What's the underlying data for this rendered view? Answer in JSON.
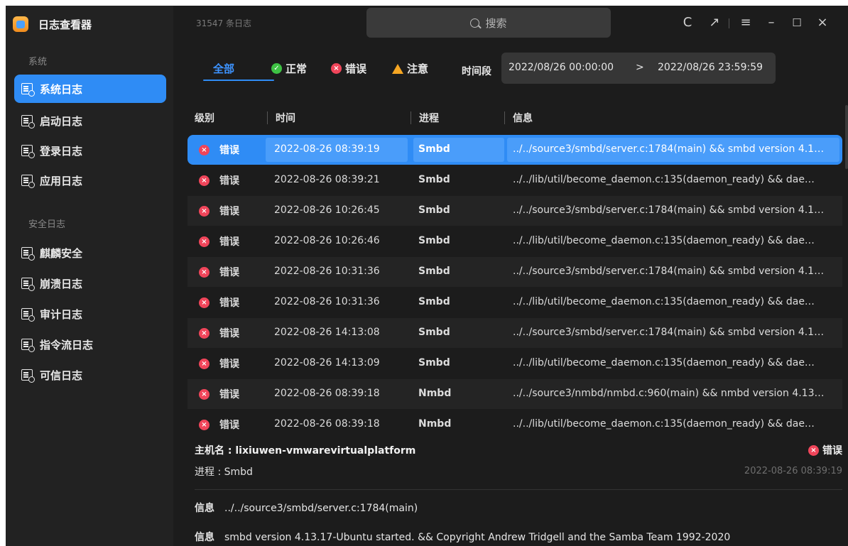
{
  "app": {
    "title": "日志查看器"
  },
  "sidebar": {
    "section_system": "系统",
    "section_security": "安全日志",
    "items": [
      {
        "label": "系统日志"
      },
      {
        "label": "启动日志"
      },
      {
        "label": "登录日志"
      },
      {
        "label": "应用日志"
      },
      {
        "label": "麒麟安全"
      },
      {
        "label": "崩溃日志"
      },
      {
        "label": "审计日志"
      },
      {
        "label": "指令流日志"
      },
      {
        "label": "可信日志"
      }
    ]
  },
  "titlebar": {
    "count": "31547 条日志",
    "search_placeholder": "搜索",
    "refresh_icon": "C",
    "export_icon": "↗",
    "menu_icon": "≡",
    "minimize_icon": "–",
    "maximize_icon": "☐",
    "close_icon": "×"
  },
  "filters": {
    "all": "全部",
    "normal": "正常",
    "error": "错误",
    "warning": "注意",
    "period_label": "时间段",
    "start": "2022/08/26 00:00:00",
    "arrow": ">",
    "end": "2022/08/26 23:59:59"
  },
  "table": {
    "headers": {
      "level": "级别",
      "time": "时间",
      "process": "进程",
      "info": "信息"
    },
    "rows": [
      {
        "level": "错误",
        "time": "2022-08-26 08:39:19",
        "process": "Smbd",
        "info": "../../source3/smbd/server.c:1784(main) && smbd version 4.1…"
      },
      {
        "level": "错误",
        "time": "2022-08-26 08:39:21",
        "process": "Smbd",
        "info": "../../lib/util/become_daemon.c:135(daemon_ready) && dae…"
      },
      {
        "level": "错误",
        "time": "2022-08-26 10:26:45",
        "process": "Smbd",
        "info": "../../source3/smbd/server.c:1784(main) && smbd version 4.1…"
      },
      {
        "level": "错误",
        "time": "2022-08-26 10:26:46",
        "process": "Smbd",
        "info": "../../lib/util/become_daemon.c:135(daemon_ready) && dae…"
      },
      {
        "level": "错误",
        "time": "2022-08-26 10:31:36",
        "process": "Smbd",
        "info": "../../source3/smbd/server.c:1784(main) && smbd version 4.1…"
      },
      {
        "level": "错误",
        "time": "2022-08-26 10:31:36",
        "process": "Smbd",
        "info": "../../lib/util/become_daemon.c:135(daemon_ready) && dae…"
      },
      {
        "level": "错误",
        "time": "2022-08-26 14:13:08",
        "process": "Smbd",
        "info": "../../source3/smbd/server.c:1784(main) && smbd version 4.1…"
      },
      {
        "level": "错误",
        "time": "2022-08-26 14:13:09",
        "process": "Smbd",
        "info": "../../lib/util/become_daemon.c:135(daemon_ready) && dae…"
      },
      {
        "level": "错误",
        "time": "2022-08-26 08:39:18",
        "process": "Nmbd",
        "info": "../../source3/nmbd/nmbd.c:960(main) && nmbd version 4.13…"
      },
      {
        "level": "错误",
        "time": "2022-08-26 08:39:18",
        "process": "Nmbd",
        "info": "../../lib/util/become_daemon.c:135(daemon_ready) && dae…"
      }
    ]
  },
  "detail": {
    "host": "主机名 : lixiuwen-vmwarevirtualplatform",
    "process": "进程 : Smbd",
    "level": "错误",
    "time": "2022-08-26 08:39:19",
    "info_key": "信息",
    "info1": "../../source3/smbd/server.c:1784(main)",
    "info2": "smbd version 4.13.17-Ubuntu started. && Copyright Andrew Tridgell and the Samba Team 1992-2020"
  },
  "colors": {
    "accent": "#2f8cf5",
    "error": "#f0455a",
    "normal": "#3ec244",
    "warning": "#f5a623"
  }
}
